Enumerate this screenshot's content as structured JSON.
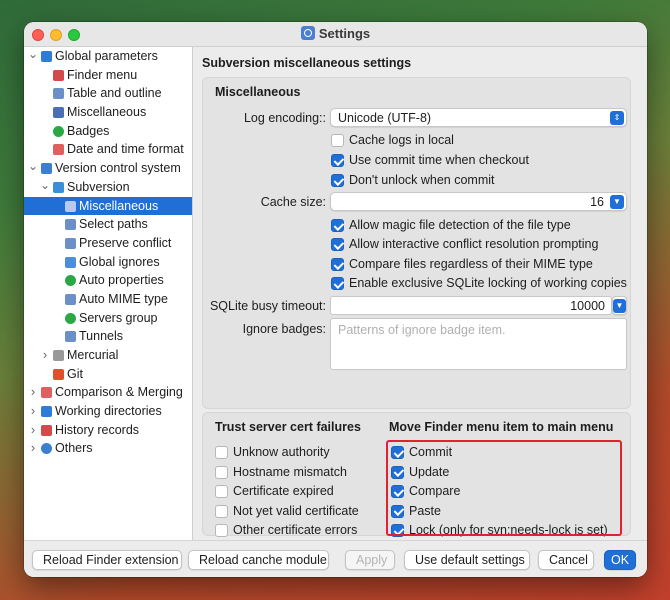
{
  "window": {
    "title": "Settings"
  },
  "sidebar": {
    "items": [
      {
        "label": "Global parameters",
        "level": 0,
        "expanded": true,
        "icon": "gear-icon",
        "color": "#2f7cd8"
      },
      {
        "label": "Finder menu",
        "level": 1,
        "icon": "pointer-icon",
        "color": "#d24a4a"
      },
      {
        "label": "Table and outline",
        "level": 1,
        "icon": "table-icon",
        "color": "#6c8fc8"
      },
      {
        "label": "Miscellaneous",
        "level": 1,
        "icon": "grid-icon",
        "color": "#4a6fb5"
      },
      {
        "label": "Badges",
        "level": 1,
        "icon": "badge-icon",
        "color": "#2aa845"
      },
      {
        "label": "Date and time format",
        "level": 1,
        "icon": "calendar-icon",
        "color": "#e06060"
      },
      {
        "label": "Version control system",
        "level": 0,
        "expanded": true,
        "icon": "layers-icon",
        "color": "#3c7fd0"
      },
      {
        "label": "Subversion",
        "level": 1,
        "expanded": true,
        "icon": "svn-icon",
        "color": "#3a8fd8"
      },
      {
        "label": "Miscellaneous",
        "level": 2,
        "selected": true,
        "icon": "grid-icon",
        "color": "#b7c9ee"
      },
      {
        "label": "Select paths",
        "level": 2,
        "icon": "list-icon",
        "color": "#6c8fc8"
      },
      {
        "label": "Preserve conflict",
        "level": 2,
        "icon": "list-icon",
        "color": "#6c8fc8"
      },
      {
        "label": "Global ignores",
        "level": 2,
        "icon": "ignore-icon",
        "color": "#4a8fd8"
      },
      {
        "label": "Auto properties",
        "level": 2,
        "icon": "properties-icon",
        "color": "#2aa845"
      },
      {
        "label": "Auto MIME type",
        "level": 2,
        "icon": "mime-icon",
        "color": "#6c8fc8"
      },
      {
        "label": "Servers group",
        "level": 2,
        "icon": "server-icon",
        "color": "#2aa845"
      },
      {
        "label": "Tunnels",
        "level": 2,
        "icon": "tunnel-icon",
        "color": "#6c8fc8"
      },
      {
        "label": "Mercurial",
        "level": 1,
        "collapsed": true,
        "icon": "mercurial-icon",
        "color": "#999999"
      },
      {
        "label": "Git",
        "level": 1,
        "icon": "git-icon",
        "color": "#e0502a"
      },
      {
        "label": "Comparison & Merging",
        "level": 0,
        "collapsed": true,
        "icon": "compare-icon",
        "color": "#e06060"
      },
      {
        "label": "Working directories",
        "level": 0,
        "collapsed": true,
        "icon": "folder-icon",
        "color": "#2f7cd8"
      },
      {
        "label": "History records",
        "level": 0,
        "collapsed": true,
        "icon": "history-icon",
        "color": "#d24a4a"
      },
      {
        "label": "Others",
        "level": 0,
        "collapsed": true,
        "icon": "others-icon",
        "color": "#3c7fd0"
      }
    ]
  },
  "main": {
    "title": "Subversion miscellaneous settings",
    "misc": {
      "title": "Miscellaneous",
      "log_encoding_label": "Log encoding::",
      "log_encoding_value": "Unicode (UTF-8)",
      "cache_logs": {
        "label": "Cache logs in local",
        "checked": false
      },
      "commit_time": {
        "label": "Use commit time when checkout",
        "checked": true
      },
      "dont_unlock": {
        "label": "Don't unlock when commit",
        "checked": true
      },
      "cache_size_label": "Cache size:",
      "cache_size_value": "16",
      "magic_detect": {
        "label": "Allow magic file detection of the file type",
        "checked": true
      },
      "interactive_conflict": {
        "label": "Allow interactive conflict resolution prompting",
        "checked": true
      },
      "compare_mime": {
        "label": "Compare files regardless of their MIME type",
        "checked": true
      },
      "sqlite_locking": {
        "label": "Enable exclusive SQLite locking of working copies",
        "checked": true
      },
      "sqlite_timeout_label": "SQLite busy timeout:",
      "sqlite_timeout_value": "10000",
      "ignore_badges_label": "Ignore badges:",
      "ignore_badges_placeholder": "Patterns of ignore badge item."
    },
    "trust": {
      "title": "Trust server cert failures",
      "items": [
        {
          "label": "Unknow authority",
          "checked": false
        },
        {
          "label": "Hostname mismatch",
          "checked": false
        },
        {
          "label": "Certificate expired",
          "checked": false
        },
        {
          "label": "Not yet valid certificate",
          "checked": false
        },
        {
          "label": "Other certificate errors",
          "checked": false
        }
      ]
    },
    "finder_move": {
      "title": "Move Finder menu item to main menu",
      "items": [
        {
          "label": "Commit",
          "checked": true
        },
        {
          "label": "Update",
          "checked": true
        },
        {
          "label": "Compare",
          "checked": true
        },
        {
          "label": "Paste",
          "checked": true
        },
        {
          "label": "Lock (only for svn:needs-lock is set)",
          "checked": true
        }
      ]
    }
  },
  "bottom": {
    "reload_finder": "Reload Finder extension",
    "reload_module": "Reload canche module",
    "apply": "Apply",
    "use_default": "Use default settings",
    "cancel": "Cancel",
    "ok": "OK"
  },
  "colors": {
    "accent": "#1f6fd6",
    "highlight": "#e0242f"
  }
}
